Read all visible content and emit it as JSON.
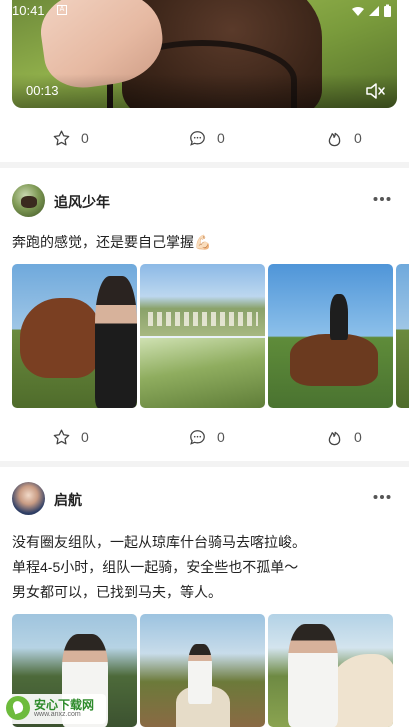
{
  "status_bar": {
    "time": "10:41",
    "indicator": "A"
  },
  "video": {
    "timestamp": "00:13",
    "mute_icon": "mute-icon"
  },
  "feed": {
    "first_actions": {
      "like": "0",
      "comment": "0",
      "hot": "0"
    },
    "posts": [
      {
        "username": "追风少年",
        "text_lines": [
          "奔跑的感觉，还是要自己掌握💪🏻"
        ],
        "actions": {
          "like": "0",
          "comment": "0",
          "hot": "0"
        }
      },
      {
        "username": "启航",
        "text_lines": [
          "没有圈友组队，一起从琼库什台骑马去喀拉峻。",
          "单程4-5小时，组队一起骑，安全些也不孤单～",
          "男女都可以，已找到马夫，等人。"
        ]
      }
    ]
  },
  "watermark": {
    "title": "安心下载网",
    "url": "www.anxz.com"
  },
  "colors": {
    "text": "#222222",
    "muted": "#555555",
    "divider": "#f3f3f3",
    "watermark": "#2d8a2a"
  },
  "icons": [
    "star-icon",
    "comment-icon",
    "flame-icon",
    "more-icon",
    "mute-icon",
    "wifi-icon",
    "signal-icon",
    "battery-icon"
  ]
}
